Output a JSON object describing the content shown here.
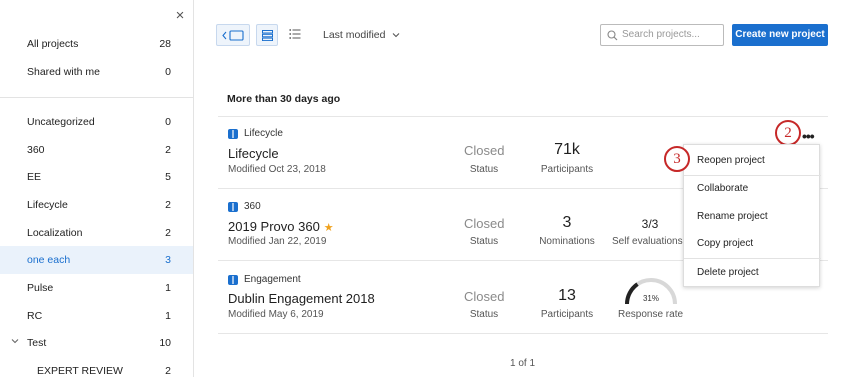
{
  "sidebar": {
    "close_icon": "×",
    "top_items": [
      {
        "label": "All projects",
        "count": "28"
      },
      {
        "label": "Shared with me",
        "count": "0"
      }
    ],
    "folders": [
      {
        "label": "Uncategorized",
        "count": "0"
      },
      {
        "label": "360",
        "count": "2"
      },
      {
        "label": "EE",
        "count": "5"
      },
      {
        "label": "Lifecycle",
        "count": "2"
      },
      {
        "label": "Localization",
        "count": "2"
      },
      {
        "label": "one each",
        "count": "3"
      },
      {
        "label": "Pulse",
        "count": "1"
      },
      {
        "label": "RC",
        "count": "1"
      },
      {
        "label": "Test",
        "count": "10"
      },
      {
        "label": "EXPERT REVIEW",
        "count": "2"
      }
    ]
  },
  "toolbar": {
    "sort_label": "Last modified",
    "search_placeholder": "Search projects...",
    "create_label": "Create new project"
  },
  "section_title": "More than 30 days ago",
  "projects": [
    {
      "type": "Lifecycle",
      "name": "Lifecycle",
      "modified": "Modified Oct 23, 2018",
      "status": "Closed",
      "status_label": "Status",
      "metric1_value": "71k",
      "metric1_label": "Participants"
    },
    {
      "type": "360",
      "name": "2019 Provo 360",
      "star": "★",
      "modified": "Modified Jan 22, 2019",
      "status": "Closed",
      "status_label": "Status",
      "metric1_value": "3",
      "metric1_label": "Nominations",
      "metric2_value": "3/3",
      "metric2_label": "Self evaluations"
    },
    {
      "type": "Engagement",
      "name": "Dublin Engagement 2018",
      "modified": "Modified May 6, 2019",
      "status": "Closed",
      "status_label": "Status",
      "metric1_value": "13",
      "metric1_label": "Participants",
      "metric2_value": "31%",
      "metric2_label": "Response rate",
      "response_rate": 0.31
    }
  ],
  "callouts": {
    "menu_button": "2",
    "reopen": "3"
  },
  "menu": {
    "items": [
      "Reopen project",
      "Collaborate",
      "Rename project",
      "Copy project",
      "Delete project"
    ]
  },
  "pager": "1 of 1",
  "colors": {
    "accent": "#1a6fce",
    "callout": "#c62828",
    "star": "#f0a11c",
    "gauge": "#222222"
  }
}
